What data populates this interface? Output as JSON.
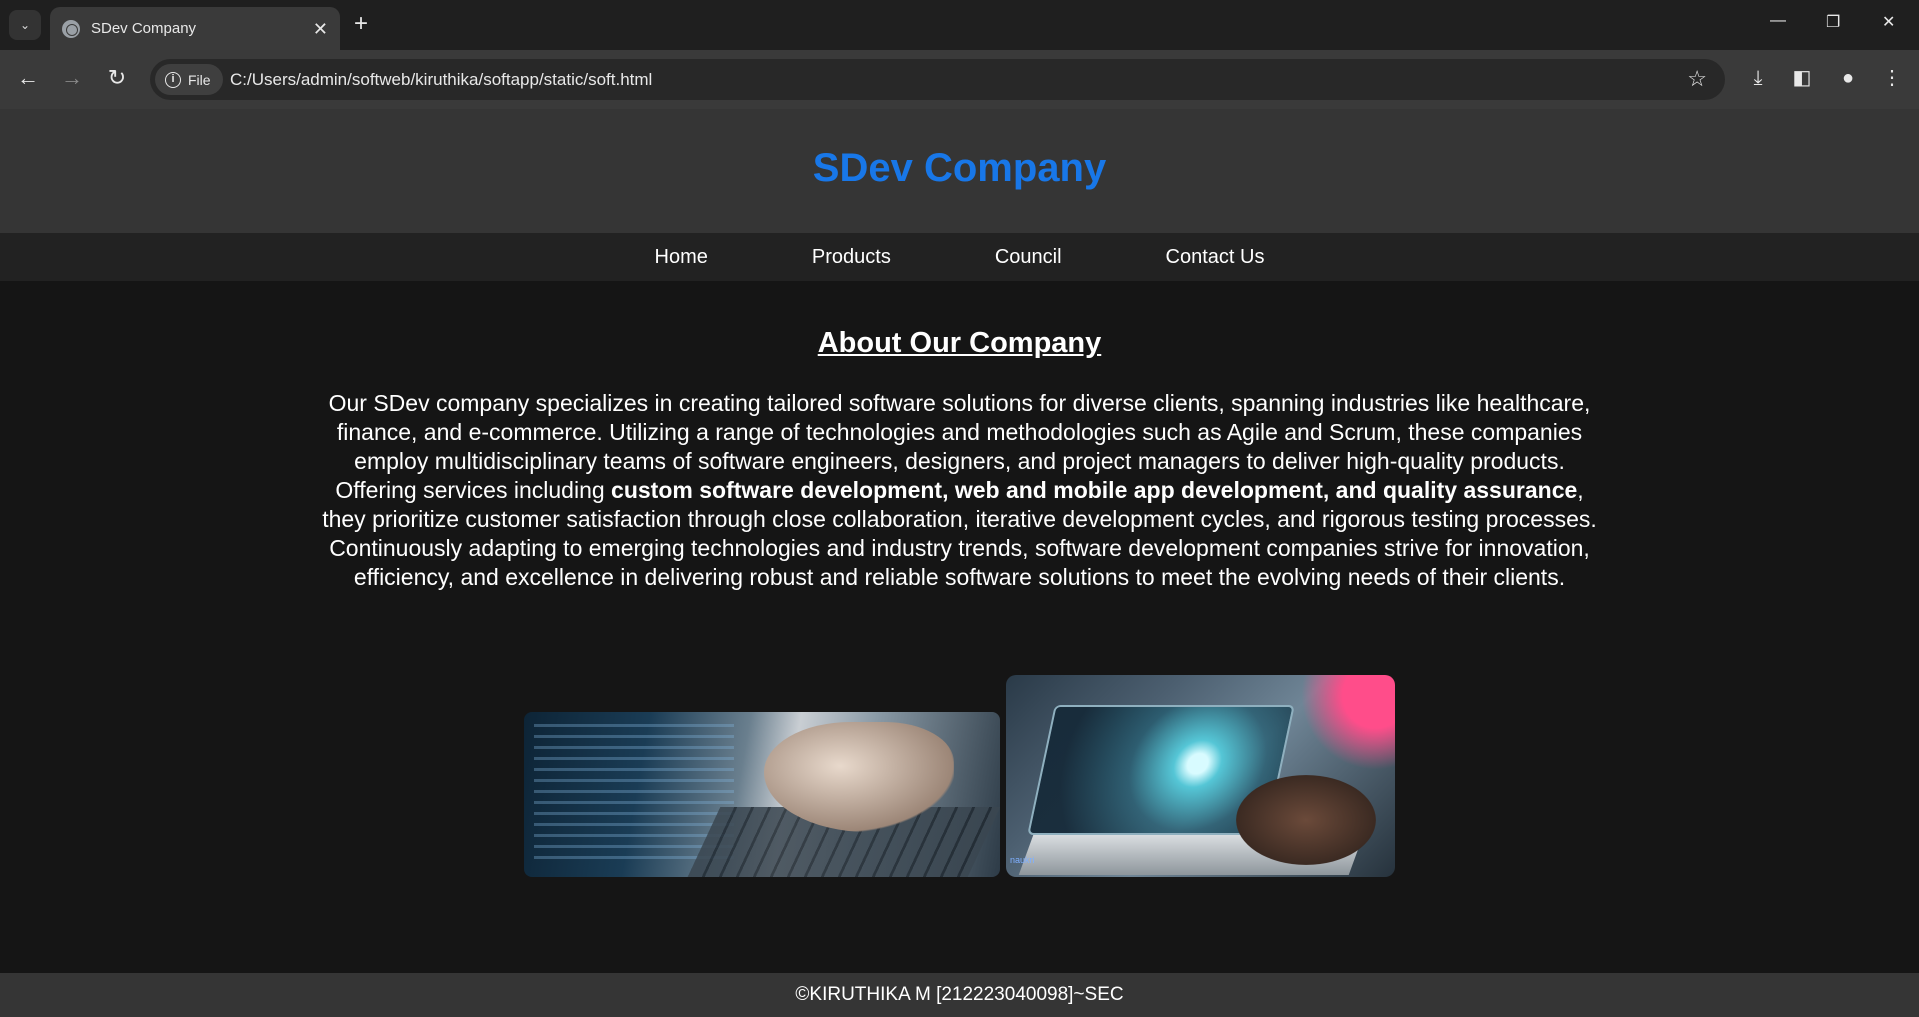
{
  "browser": {
    "tab_title": "SDev Company",
    "url_chip": "File",
    "url": "C:/Users/admin/softweb/kiruthika/softapp/static/soft.html"
  },
  "site": {
    "title": "SDev Company",
    "nav": [
      "Home",
      "Products",
      "Council",
      "Contact Us"
    ],
    "about_heading": "About Our Company",
    "about_pre": "Our SDev company specializes in creating tailored software solutions for diverse clients, spanning industries like healthcare, finance, and e-commerce. Utilizing a range of technologies and methodologies such as Agile and Scrum, these companies employ multidisciplinary teams of software engineers, designers, and project managers to deliver high-quality products. Offering services including ",
    "about_bold": "custom software development, web and mobile app development, and quality assurance",
    "about_post": ", they prioritize customer satisfaction through close collaboration, iterative development cycles, and rigorous testing processes. Continuously adapting to emerging technologies and industry trends, software development companies strive for innovation, efficiency, and excellence in delivering robust and reliable software solutions to meet the evolving needs of their clients.",
    "image_logo": "naukri",
    "footer": "©KIRUTHIKA M [212223040098]~SEC"
  },
  "colors": {
    "title_blue": "#1877e8",
    "header_bg": "#353535",
    "nav_bg": "#222222",
    "body_bg": "#151515"
  }
}
